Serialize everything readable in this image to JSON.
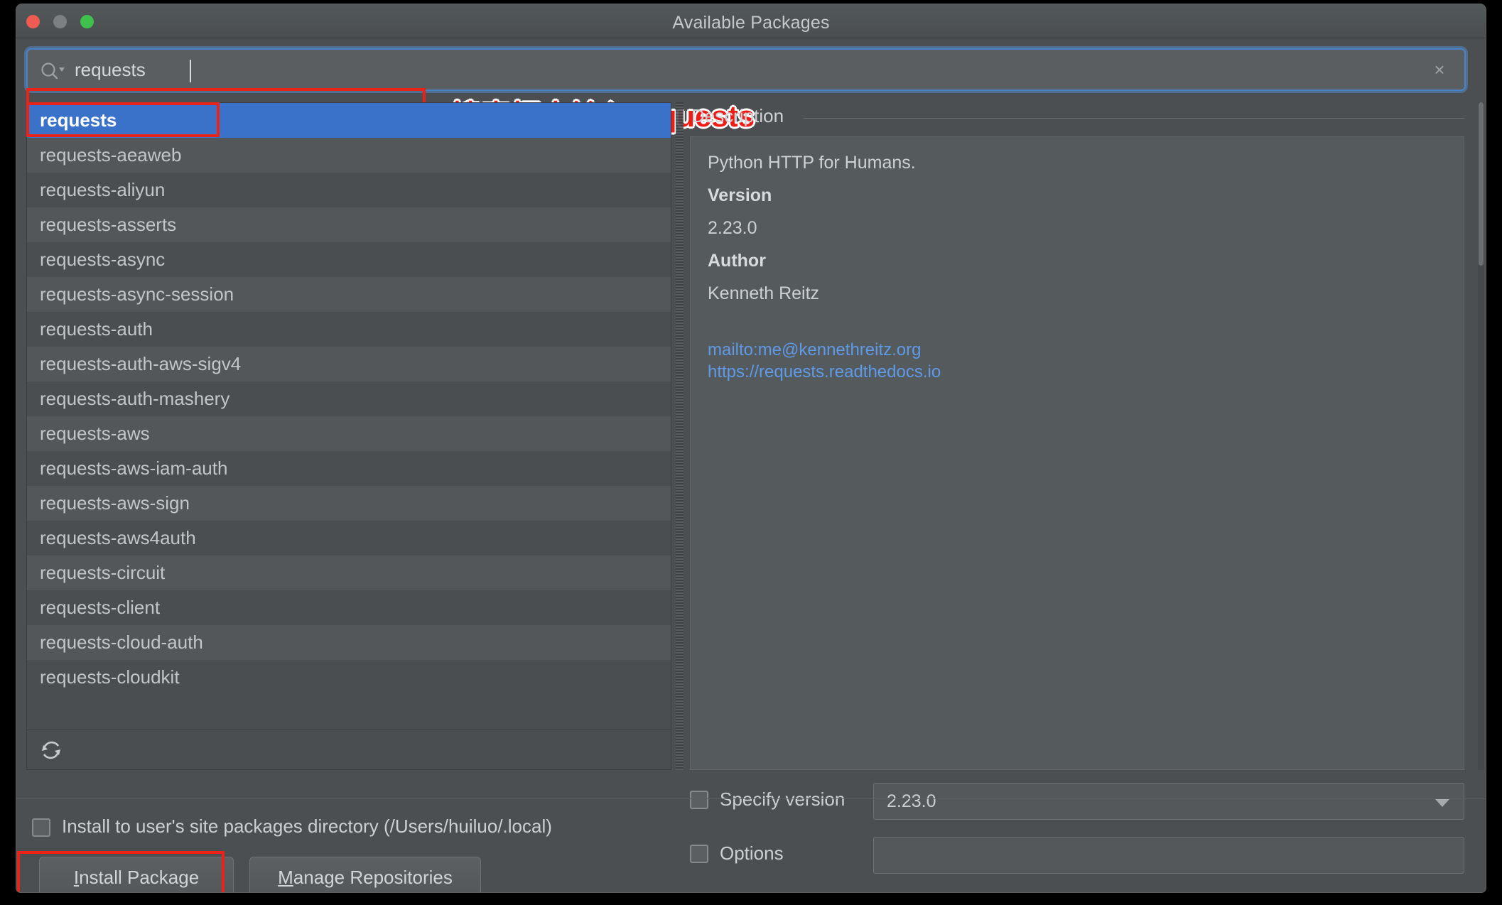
{
  "window": {
    "title": "Available Packages",
    "traffic_lights": [
      "close-red",
      "minimize-gray",
      "zoom-green"
    ]
  },
  "search": {
    "value": "requests",
    "icon": "search-icon",
    "clear_icon": "×",
    "placeholder": ""
  },
  "annotations": [
    {
      "id": "search-annotation",
      "text": "搜索框中输入requests",
      "color": "#ee1b17"
    }
  ],
  "package_list": {
    "selected_index": 0,
    "items": [
      "requests",
      "requests-aeaweb",
      "requests-aliyun",
      "requests-asserts",
      "requests-async",
      "requests-async-session",
      "requests-auth",
      "requests-auth-aws-sigv4",
      "requests-auth-mashery",
      "requests-aws",
      "requests-aws-iam-auth",
      "requests-aws-sign",
      "requests-aws4auth",
      "requests-circuit",
      "requests-client",
      "requests-cloud-auth",
      "requests-cloudkit"
    ],
    "refresh_icon": "refresh-icon"
  },
  "description": {
    "header": "Description",
    "summary": "Python HTTP for Humans.",
    "version_label": "Version",
    "version_value": "2.23.0",
    "author_label": "Author",
    "author_value": "Kenneth Reitz",
    "links": [
      "mailto:me@kennethreitz.org",
      "https://requests.readthedocs.io"
    ],
    "link_color": "#5f9ae8"
  },
  "options": {
    "specify_version_label": "Specify version",
    "specify_version_checked": false,
    "specify_version_value": "2.23.0",
    "options_label": "Options",
    "options_checked": false,
    "options_value": ""
  },
  "footer": {
    "install_user_label": "Install to user's site packages directory (/Users/huiluo/.local)",
    "install_user_checked": false,
    "install_button": {
      "mnemonic": "I",
      "rest": "nstall Package"
    },
    "manage_button": {
      "mnemonic": "M",
      "rest": "anage Repositories"
    }
  },
  "colors": {
    "window_bg": "#4b4f52",
    "selection_blue": "#3b72c9",
    "focus_blue": "#4b82c4",
    "annotation_red": "#e8231a",
    "text": "#c2c6c8"
  }
}
